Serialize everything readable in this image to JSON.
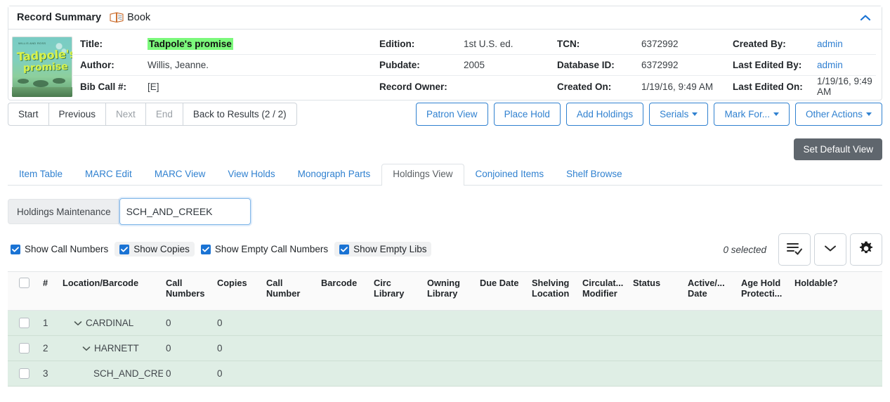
{
  "record_summary": {
    "title_label": "Record Summary",
    "record_type": "Book",
    "collapse_icon": "chevron-up-icon",
    "book_icon": "open-book-icon",
    "cover": {
      "line_top": "WILLIS AND ROSS",
      "line1": "Tadpole's",
      "line2": "promise"
    },
    "fields": {
      "title_label": "Title:",
      "title_value": "Tadpole's promise",
      "author_label": "Author:",
      "author_value": "Willis, Jeanne.",
      "bibcall_label": "Bib Call #:",
      "bibcall_value": "[E]",
      "edition_label": "Edition:",
      "edition_value": "1st U.S. ed.",
      "pubdate_label": "Pubdate:",
      "pubdate_value": "2005",
      "record_owner_label": "Record Owner:",
      "record_owner_value": "",
      "tcn_label": "TCN:",
      "tcn_value": "6372992",
      "database_id_label": "Database ID:",
      "database_id_value": "6372992",
      "created_on_label": "Created On:",
      "created_on_value": "1/19/16, 9:49 AM",
      "created_by_label": "Created By:",
      "created_by_value": "admin",
      "last_edited_by_label": "Last Edited By:",
      "last_edited_by_value": "admin",
      "last_edited_on_label": "Last Edited On:",
      "last_edited_on_value": "1/19/16, 9:49 AM"
    },
    "highlight_color": "#7cf97c"
  },
  "nav_buttons": [
    {
      "label": "Start",
      "disabled": false
    },
    {
      "label": "Previous",
      "disabled": false
    },
    {
      "label": "Next",
      "disabled": true
    },
    {
      "label": "End",
      "disabled": true
    },
    {
      "label": "Back to Results (2 / 2)",
      "disabled": false
    }
  ],
  "action_buttons": [
    {
      "label": "Patron View",
      "caret": false
    },
    {
      "label": "Place Hold",
      "caret": false
    },
    {
      "label": "Add Holdings",
      "caret": false
    },
    {
      "label": "Serials",
      "caret": true
    },
    {
      "label": "Mark For...",
      "caret": true
    },
    {
      "label": "Other Actions",
      "caret": true
    }
  ],
  "set_default_view_label": "Set Default View",
  "tabs": [
    {
      "label": "Item Table",
      "active": false
    },
    {
      "label": "MARC Edit",
      "active": false
    },
    {
      "label": "MARC View",
      "active": false
    },
    {
      "label": "View Holds",
      "active": false
    },
    {
      "label": "Monograph Parts",
      "active": false
    },
    {
      "label": "Holdings View",
      "active": true
    },
    {
      "label": "Conjoined Items",
      "active": false
    },
    {
      "label": "Shelf Browse",
      "active": false
    }
  ],
  "holdings_maintenance": {
    "label": "Holdings Maintenance",
    "input_value": "SCH_AND_CREEK",
    "input_placeholder": ""
  },
  "filters": [
    {
      "label": "Show Call Numbers",
      "checked": true,
      "hovered": false
    },
    {
      "label": "Show Copies",
      "checked": true,
      "hovered": true
    },
    {
      "label": "Show Empty Call Numbers",
      "checked": true,
      "hovered": false
    },
    {
      "label": "Show Empty Libs",
      "checked": true,
      "hovered": true
    }
  ],
  "toolbar": {
    "selected_text": "0 selected",
    "buttons": [
      {
        "icon": "list-check-icon"
      },
      {
        "icon": "chevron-down-icon"
      },
      {
        "icon": "gear-icon"
      }
    ]
  },
  "table": {
    "columns": [
      "#",
      "Location/Barcode",
      "Call Numbers",
      "Copies",
      "Call Number",
      "Barcode",
      "Circ Library",
      "Owning Library",
      "Due Date",
      "Shelving Location",
      "Circulat... Modifier",
      "Status",
      "Active/... Date",
      "Age Hold Protecti...",
      "Holdable?"
    ],
    "columns_split": [
      {
        "l1": "#",
        "l2": ""
      },
      {
        "l1": "Location/Barcode",
        "l2": ""
      },
      {
        "l1": "Call",
        "l2": "Numbers"
      },
      {
        "l1": "Copies",
        "l2": ""
      },
      {
        "l1": "Call",
        "l2": "Number"
      },
      {
        "l1": "Barcode",
        "l2": ""
      },
      {
        "l1": "Circ",
        "l2": "Library"
      },
      {
        "l1": "Owning",
        "l2": "Library"
      },
      {
        "l1": "Due Date",
        "l2": ""
      },
      {
        "l1": "Shelving",
        "l2": "Location"
      },
      {
        "l1": "Circulat...",
        "l2": "Modifier"
      },
      {
        "l1": "Status",
        "l2": ""
      },
      {
        "l1": "Active/...",
        "l2": "Date"
      },
      {
        "l1": "Age Hold",
        "l2": "Protecti..."
      },
      {
        "l1": "Holdable?",
        "l2": ""
      }
    ],
    "rows": [
      {
        "num": "1",
        "location": "CARDINAL",
        "indent": 1,
        "expander": "chevron-down-icon",
        "call_numbers": "0",
        "copies": "0",
        "call_number": "",
        "barcode": "",
        "circ_library": "",
        "owning_library": "",
        "due_date": "",
        "shelving_location": "",
        "circ_modifier": "",
        "status": "",
        "active_date": "",
        "age_hold": "",
        "holdable": "",
        "checked": false
      },
      {
        "num": "2",
        "location": "HARNETT",
        "indent": 2,
        "expander": "chevron-down-icon",
        "call_numbers": "0",
        "copies": "0",
        "call_number": "",
        "barcode": "",
        "circ_library": "",
        "owning_library": "",
        "due_date": "",
        "shelving_location": "",
        "circ_modifier": "",
        "status": "",
        "active_date": "",
        "age_hold": "",
        "holdable": "",
        "checked": false
      },
      {
        "num": "3",
        "location": "SCH_AND_CREE",
        "indent": 3,
        "expander": "",
        "call_numbers": "0",
        "copies": "0",
        "call_number": "",
        "barcode": "",
        "circ_library": "",
        "owning_library": "",
        "due_date": "",
        "shelving_location": "",
        "circ_modifier": "",
        "status": "",
        "active_date": "",
        "age_hold": "",
        "holdable": "",
        "checked": false
      }
    ],
    "row_bg_color": "#dfeee5"
  }
}
